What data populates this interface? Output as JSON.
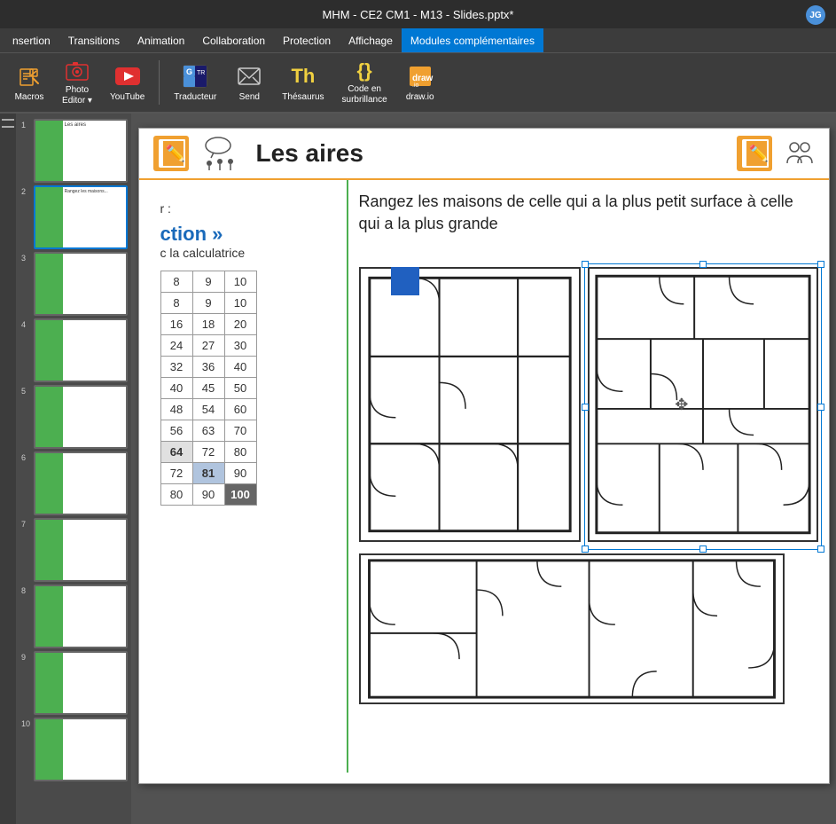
{
  "titleBar": {
    "title": "MHM - CE2 CM1 - M13 - Slides.pptx*",
    "avatar": "JG"
  },
  "menuBar": {
    "items": [
      {
        "label": "nsertion",
        "active": false
      },
      {
        "label": "Transitions",
        "active": false
      },
      {
        "label": "Animation",
        "active": false
      },
      {
        "label": "Collaboration",
        "active": false
      },
      {
        "label": "Protection",
        "active": false
      },
      {
        "label": "Affichage",
        "active": false
      },
      {
        "label": "Modules complémentaires",
        "active": true
      }
    ]
  },
  "toolbar": {
    "buttons": [
      {
        "id": "macros",
        "label": "Macros",
        "icon": "🔧"
      },
      {
        "id": "photo-editor",
        "label": "Photo\nEditor ▾",
        "icon": "📷"
      },
      {
        "id": "youtube",
        "label": "YouTube",
        "icon": "▶"
      },
      {
        "id": "traducteur",
        "label": "Traducteur",
        "icon": "TR"
      },
      {
        "id": "send",
        "label": "Send",
        "icon": "✉"
      },
      {
        "id": "thesaurus",
        "label": "Thésaurus",
        "icon": "Th"
      },
      {
        "id": "code",
        "label": "Code en\nsurbrillance",
        "icon": "{}"
      },
      {
        "id": "drawio",
        "label": "draw.io",
        "icon": "⬡"
      }
    ]
  },
  "slide": {
    "header": {
      "title": "Les aires",
      "leftIcon": "📗",
      "rightIcon": "📗",
      "groupIcon": "👥"
    },
    "leftPanel": {
      "labelR": "r :",
      "instructionBold": "ction »",
      "instructionText": "c la calculatrice",
      "tableData": [
        [
          8,
          9,
          10
        ],
        [
          8,
          9,
          10
        ],
        [
          16,
          18,
          20
        ],
        [
          24,
          27,
          30
        ],
        [
          32,
          36,
          40
        ],
        [
          40,
          45,
          50
        ],
        [
          48,
          54,
          60
        ],
        [
          56,
          63,
          70
        ],
        [
          64,
          72,
          80
        ],
        [
          72,
          81,
          90
        ],
        [
          80,
          90,
          100
        ]
      ]
    },
    "rightPanel": {
      "question": "Rangez les maisons de celle qui a la plus petit surface à celle qui a la plus grande"
    }
  }
}
